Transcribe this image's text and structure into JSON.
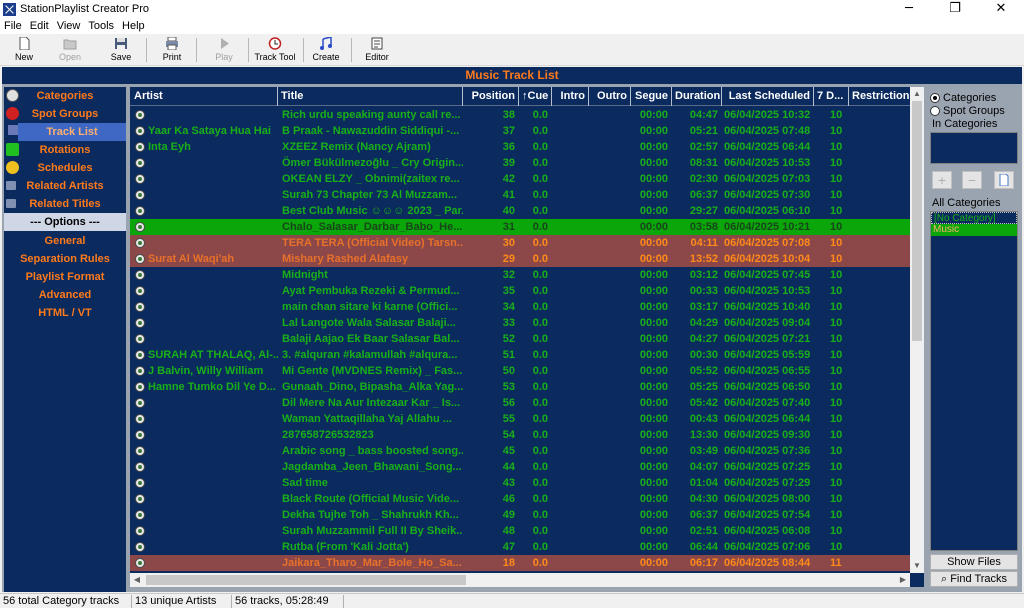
{
  "window": {
    "title": "StationPlaylist Creator Pro",
    "minimize": "─",
    "maximize": "❐",
    "close": "✕"
  },
  "menu": [
    "File",
    "Edit",
    "View",
    "Tools",
    "Help"
  ],
  "toolbar": {
    "new": "New",
    "open": "Open",
    "save": "Save",
    "print": "Print",
    "play": "Play",
    "track_tool": "Track Tool",
    "create": "Create",
    "editor": "Editor"
  },
  "header": "Music Track List",
  "nav": {
    "categories": "Categories",
    "spot_groups": "Spot Groups",
    "track_list": "Track List",
    "rotations": "Rotations",
    "schedules": "Schedules",
    "related_artists": "Related Artists",
    "related_titles": "Related Titles",
    "options_header": "--- Options ---",
    "general": "General",
    "separation_rules": "Separation Rules",
    "playlist_format": "Playlist Format",
    "advanced": "Advanced",
    "html_vt": "HTML / VT"
  },
  "columns": {
    "artist": "Artist",
    "title": "Title",
    "position": "Position",
    "cue": "↑Cue",
    "intro": "Intro",
    "outro": "Outro",
    "segue": "Segue",
    "duration": "Duration",
    "last_scheduled": "Last Scheduled",
    "seven_day": "7 D...",
    "restrictions": "Restrictions"
  },
  "rows": [
    {
      "artist": "",
      "title": "Rich urdu speaking aunty call re...",
      "position": "38",
      "cue": "0.0",
      "segue": "00:00",
      "duration": "04:47",
      "last": "06/04/2025 10:32",
      "d7": "10",
      "hl": ""
    },
    {
      "artist": "Yaar Ka Sataya Hua Hai",
      "title": "B Praak - Nawazuddin Siddiqui -...",
      "position": "37",
      "cue": "0.0",
      "segue": "00:00",
      "duration": "05:21",
      "last": "06/04/2025 07:48",
      "d7": "10",
      "hl": ""
    },
    {
      "artist": "Inta Eyh",
      "title": "XZEEZ Remix (Nancy Ajram)",
      "position": "36",
      "cue": "0.0",
      "segue": "00:00",
      "duration": "02:57",
      "last": "06/04/2025 06:44",
      "d7": "10",
      "hl": ""
    },
    {
      "artist": "",
      "title": "Ömer Bükülmezoğlu _ Cry Origin...",
      "position": "39",
      "cue": "0.0",
      "segue": "00:00",
      "duration": "08:31",
      "last": "06/04/2025 10:53",
      "d7": "10",
      "hl": ""
    },
    {
      "artist": "",
      "title": "OKEAN ELZY _ Obnimi(zaitex re...",
      "position": "42",
      "cue": "0.0",
      "segue": "00:00",
      "duration": "02:30",
      "last": "06/04/2025 07:03",
      "d7": "10",
      "hl": ""
    },
    {
      "artist": "",
      "title": "Surah 73 Chapter 73 Al Muzzam...",
      "position": "41",
      "cue": "0.0",
      "segue": "00:00",
      "duration": "06:37",
      "last": "06/04/2025 07:30",
      "d7": "10",
      "hl": ""
    },
    {
      "artist": "",
      "title": "Best Club Music ☺☺☺ 2023 _ Par...",
      "position": "40",
      "cue": "0.0",
      "segue": "00:00",
      "duration": "29:27",
      "last": "06/04/2025 06:10",
      "d7": "10",
      "hl": ""
    },
    {
      "artist": "",
      "title": "Chalo_Salasar_Darbar_Babo_He...",
      "position": "31",
      "cue": "0.0",
      "segue": "00:00",
      "duration": "03:58",
      "last": "06/04/2025 10:21",
      "d7": "10",
      "hl": "green"
    },
    {
      "artist": "",
      "title": "TERA TERA (Official Video) Tarsn...",
      "position": "30",
      "cue": "0.0",
      "segue": "00:00",
      "duration": "04:11",
      "last": "06/04/2025 07:08",
      "d7": "10",
      "hl": "red"
    },
    {
      "artist": "Surat Al Waqi'ah",
      "title": "Mishary Rashed Alafasy",
      "position": "29",
      "cue": "0.0",
      "segue": "00:00",
      "duration": "13:52",
      "last": "06/04/2025 10:04",
      "d7": "10",
      "hl": "red"
    },
    {
      "artist": "",
      "title": "Midnight",
      "position": "32",
      "cue": "0.0",
      "segue": "00:00",
      "duration": "03:12",
      "last": "06/04/2025 07:45",
      "d7": "10",
      "hl": ""
    },
    {
      "artist": "",
      "title": "Ayat Pembuka Rezeki & Permud...",
      "position": "35",
      "cue": "0.0",
      "segue": "00:00",
      "duration": "00:33",
      "last": "06/04/2025 10:53",
      "d7": "10",
      "hl": ""
    },
    {
      "artist": "",
      "title": "main chan sitare ki karne (Offici...",
      "position": "34",
      "cue": "0.0",
      "segue": "00:00",
      "duration": "03:17",
      "last": "06/04/2025 10:40",
      "d7": "10",
      "hl": ""
    },
    {
      "artist": "",
      "title": "Lal Langote Wala Salasar Balaji...",
      "position": "33",
      "cue": "0.0",
      "segue": "00:00",
      "duration": "04:29",
      "last": "06/04/2025 09:04",
      "d7": "10",
      "hl": ""
    },
    {
      "artist": "",
      "title": "Balaji Aajao Ek Baar Salasar Bal...",
      "position": "52",
      "cue": "0.0",
      "segue": "00:00",
      "duration": "04:27",
      "last": "06/04/2025 07:21",
      "d7": "10",
      "hl": ""
    },
    {
      "artist": "SURAH AT THALAQ, Al-...",
      "title": "3. #alquran #kalamullah #alqura...",
      "position": "51",
      "cue": "0.0",
      "segue": "00:00",
      "duration": "00:30",
      "last": "06/04/2025 05:59",
      "d7": "10",
      "hl": ""
    },
    {
      "artist": "J Balvin, Willy William",
      "title": "Mi Gente (MVDNES Remix) _ Fas...",
      "position": "50",
      "cue": "0.0",
      "segue": "00:00",
      "duration": "05:52",
      "last": "06/04/2025 06:55",
      "d7": "10",
      "hl": ""
    },
    {
      "artist": "Hamne Tumko Dil Ye D...",
      "title": "Gunaah_Dino, Bipasha_Alka Yag...",
      "position": "53",
      "cue": "0.0",
      "segue": "00:00",
      "duration": "05:25",
      "last": "06/04/2025 06:50",
      "d7": "10",
      "hl": ""
    },
    {
      "artist": "",
      "title": "Dil Mere Na Aur Intezaar Kar _ Is...",
      "position": "56",
      "cue": "0.0",
      "segue": "00:00",
      "duration": "05:42",
      "last": "06/04/2025 07:40",
      "d7": "10",
      "hl": ""
    },
    {
      "artist": "",
      "title": "Waman Yattaqillaha Yaj Allahu ...",
      "position": "55",
      "cue": "0.0",
      "segue": "00:00",
      "duration": "00:43",
      "last": "06/04/2025 06:44",
      "d7": "10",
      "hl": ""
    },
    {
      "artist": "",
      "title": "287658726532823",
      "position": "54",
      "cue": "0.0",
      "segue": "00:00",
      "duration": "13:30",
      "last": "06/04/2025 09:30",
      "d7": "10",
      "hl": ""
    },
    {
      "artist": "",
      "title": "Arabic song _ bass boosted song...",
      "position": "45",
      "cue": "0.0",
      "segue": "00:00",
      "duration": "03:49",
      "last": "06/04/2025 07:36",
      "d7": "10",
      "hl": ""
    },
    {
      "artist": "",
      "title": "Jagdamba_Jeen_Bhawani_Song...",
      "position": "44",
      "cue": "0.0",
      "segue": "00:00",
      "duration": "04:07",
      "last": "06/04/2025 07:25",
      "d7": "10",
      "hl": ""
    },
    {
      "artist": "",
      "title": "Sad time",
      "position": "43",
      "cue": "0.0",
      "segue": "00:00",
      "duration": "01:04",
      "last": "06/04/2025 07:29",
      "d7": "10",
      "hl": ""
    },
    {
      "artist": "",
      "title": "Black Route  (Official Music Vide...",
      "position": "46",
      "cue": "0.0",
      "segue": "00:00",
      "duration": "04:30",
      "last": "06/04/2025 08:00",
      "d7": "10",
      "hl": ""
    },
    {
      "artist": "",
      "title": "Dekha Tujhe Toh _ Shahrukh Kh...",
      "position": "49",
      "cue": "0.0",
      "segue": "00:00",
      "duration": "06:37",
      "last": "06/04/2025 07:54",
      "d7": "10",
      "hl": ""
    },
    {
      "artist": "",
      "title": "Surah Muzzammil Full II By Sheik...",
      "position": "48",
      "cue": "0.0",
      "segue": "00:00",
      "duration": "02:51",
      "last": "06/04/2025 06:08",
      "d7": "10",
      "hl": ""
    },
    {
      "artist": "",
      "title": "Rutba (From 'Kali Jotta')",
      "position": "47",
      "cue": "0.0",
      "segue": "00:00",
      "duration": "06:44",
      "last": "06/04/2025 07:06",
      "d7": "10",
      "hl": ""
    },
    {
      "artist": "",
      "title": "Jaikara_Tharo_Mar_Bole_Ho_Sa...",
      "position": "18",
      "cue": "0.0",
      "segue": "00:00",
      "duration": "06:17",
      "last": "06/04/2025 08:44",
      "d7": "11",
      "hl": "red"
    }
  ],
  "right_panel": {
    "radio_categories": "Categories",
    "radio_spot_groups": "Spot Groups",
    "in_categories": "In Categories",
    "all_categories": "All Categories",
    "cat_items": [
      "[No Category]",
      "Music"
    ],
    "show_files": "Show Files",
    "find_tracks": "Find Tracks"
  },
  "status": {
    "total": "56 total Category tracks",
    "artists": "13 unique Artists",
    "tracks": "56 tracks, 05:28:49"
  },
  "colors": {
    "panel_bg": "#0b2a5e",
    "text_green": "#18b018",
    "text_orange": "#ff7a1a",
    "row_green": "#0aa60a",
    "row_red": "#8c4848"
  }
}
